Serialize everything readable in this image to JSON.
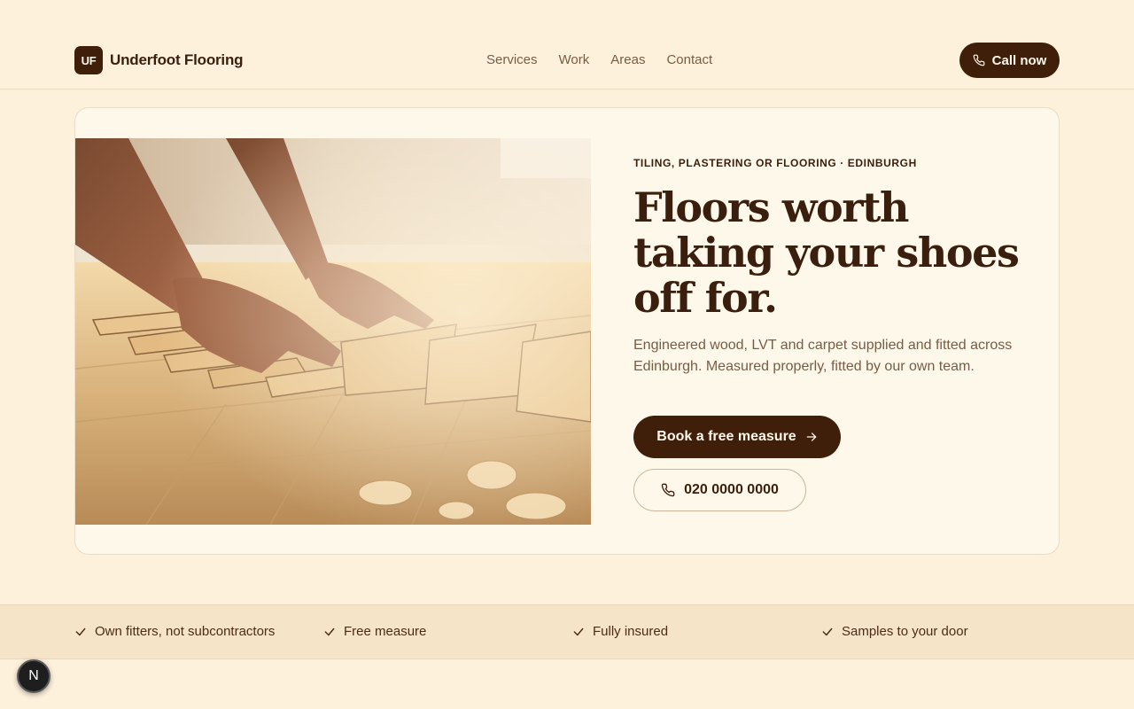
{
  "brand": {
    "logo_text": "UF",
    "name": "Underfoot Flooring"
  },
  "nav": {
    "items": [
      "Services",
      "Work",
      "Areas",
      "Contact"
    ]
  },
  "header": {
    "call_label": "Call now"
  },
  "hero": {
    "eyebrow": "TILING, PLASTERING OR FLOORING · EDINBURGH",
    "headline_lines": [
      "Floors worth",
      "taking your shoes",
      "off for."
    ],
    "subcopy": "Engineered wood, LVT and carpet supplied and fitted across Edinburgh. Measured properly, fitted by our own team.",
    "primary_cta": "Book a free measure",
    "phone": "020 0000 0000"
  },
  "trust": {
    "items": [
      "Own fitters, not subcontractors",
      "Free measure",
      "Fully insured",
      "Samples to your door"
    ]
  },
  "badge": {
    "letter": "N"
  },
  "icons": {
    "phone": "phone-icon",
    "arrow": "arrow-right-icon",
    "check": "check-icon"
  },
  "colors": {
    "background": "#fdf1dc",
    "brand_dark": "#3f1f0a",
    "text_muted": "#7a5c44",
    "card": "#fef8eb",
    "strip": "#f6e4c8"
  }
}
